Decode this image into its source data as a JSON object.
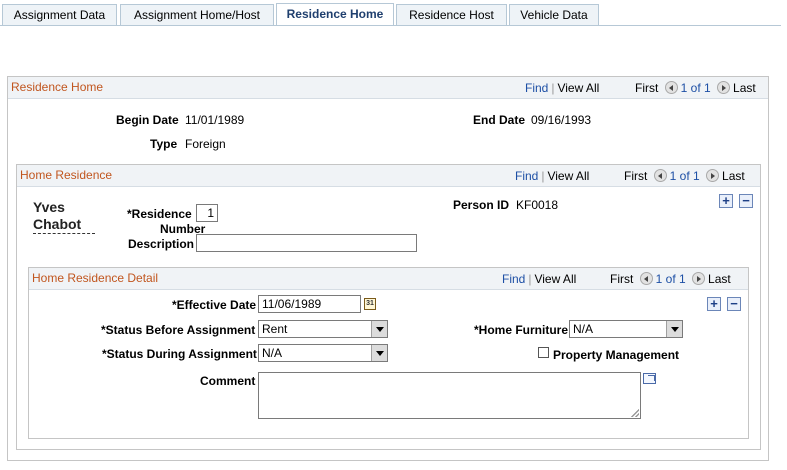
{
  "tabs": [
    {
      "label": "Assignment Data"
    },
    {
      "label": "Assignment Home/Host"
    },
    {
      "label": "Residence Home"
    },
    {
      "label": "Residence Host"
    },
    {
      "label": "Vehicle Data"
    }
  ],
  "residence_home": {
    "title": "Residence Home",
    "nav": {
      "find": "Find",
      "view_all": "View All",
      "first": "First",
      "count": "1 of 1",
      "last": "Last"
    },
    "begin_date_label": "Begin Date",
    "begin_date": "11/01/1989",
    "end_date_label": "End Date",
    "end_date": "09/16/1993",
    "type_label": "Type",
    "type": "Foreign"
  },
  "home_residence": {
    "title": "Home Residence",
    "nav": {
      "find": "Find",
      "view_all": "View All",
      "first": "First",
      "count": "1 of 1",
      "last": "Last"
    },
    "name_first": "Yves",
    "name_last": "Chabot",
    "residence_number_label_1": "*Residence",
    "residence_number_label_2": "Number",
    "residence_number": "1",
    "description_label": "Description",
    "description": "",
    "person_id_label": "Person ID",
    "person_id": "KF0018"
  },
  "home_residence_detail": {
    "title": "Home Residence Detail",
    "nav": {
      "find": "Find",
      "view_all": "View All",
      "first": "First",
      "count": "1 of 1",
      "last": "Last"
    },
    "effective_date_label": "*Effective Date",
    "effective_date": "11/06/1989",
    "calendar_glyph": "31",
    "status_before_label": "*Status Before Assignment",
    "status_before": "Rent",
    "status_during_label": "*Status During Assignment",
    "status_during": "N/A",
    "home_furniture_label": "*Home Furniture",
    "home_furniture": "N/A",
    "property_management_label": "Property Management",
    "property_management_checked": false,
    "comment_label": "Comment",
    "comment": ""
  },
  "icons": {
    "add": "+",
    "remove": "−"
  },
  "colors": {
    "section_title": "#c1561f",
    "link": "#1d4fa5",
    "active_tab_text": "#1f3f6e"
  }
}
